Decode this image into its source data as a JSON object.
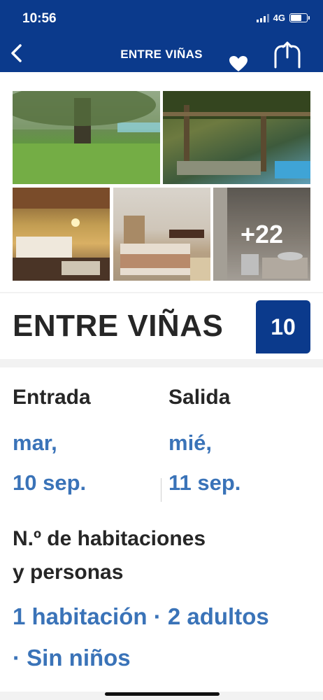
{
  "status_bar": {
    "time": "10:56",
    "network": "4G"
  },
  "header": {
    "title": "ENTRE VIÑAS",
    "back_icon": "chevron-left-icon",
    "favorite_icon": "heart-icon",
    "share_icon": "share-icon"
  },
  "gallery": {
    "more_count": "+22"
  },
  "property": {
    "name": "ENTRE VIÑAS",
    "score": "10"
  },
  "booking": {
    "checkin_label": "Entrada",
    "checkin_day": "mar,",
    "checkin_date": "10 sep.",
    "checkout_label": "Salida",
    "checkout_day": "mié,",
    "checkout_date": "11 sep.",
    "rooms_label_line1": "N.º de habitaciones",
    "rooms_label_line2": "y personas",
    "occupancy_line1": "1 habitación · 2 adultos",
    "occupancy_line2": "· Sin niños"
  },
  "colors": {
    "header_bg": "#0b3a8c",
    "link": "#3a73b8",
    "text": "#262626"
  }
}
